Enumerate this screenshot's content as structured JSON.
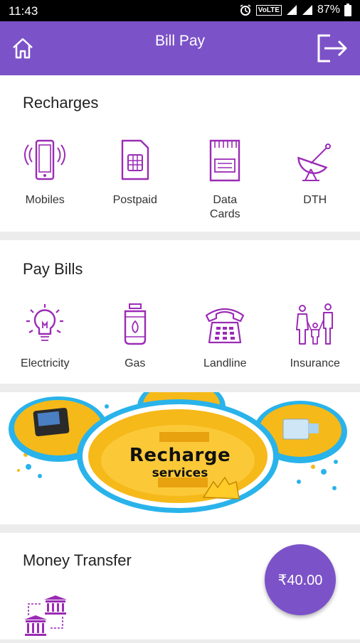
{
  "status_bar": {
    "time": "11:43",
    "network": "VoLTE",
    "battery": "87%"
  },
  "app_bar": {
    "title": "Bill Pay"
  },
  "recharges": {
    "heading": "Recharges",
    "items": [
      {
        "label": "Mobiles",
        "icon": "mobile-phone-icon"
      },
      {
        "label": "Postpaid",
        "icon": "sim-card-icon"
      },
      {
        "label": "Data\nCards",
        "icon": "data-card-icon"
      },
      {
        "label": "DTH",
        "icon": "satellite-dish-icon"
      }
    ]
  },
  "pay_bills": {
    "heading": "Pay Bills",
    "items": [
      {
        "label": "Electricity",
        "icon": "light-bulb-icon"
      },
      {
        "label": "Gas",
        "icon": "gas-cylinder-icon"
      },
      {
        "label": "Landline",
        "icon": "telephone-icon"
      },
      {
        "label": "Insurance",
        "icon": "family-icon"
      }
    ]
  },
  "banner": {
    "line1": "Recharge",
    "line2": "services"
  },
  "money_transfer": {
    "heading": "Money Transfer",
    "icon": "bank-transfer-icon"
  },
  "wallet": {
    "balance": "₹40.00"
  },
  "colors": {
    "accent": "#7c52c8",
    "banner_yellow": "#f6b91a",
    "banner_blue": "#29b3ea"
  }
}
